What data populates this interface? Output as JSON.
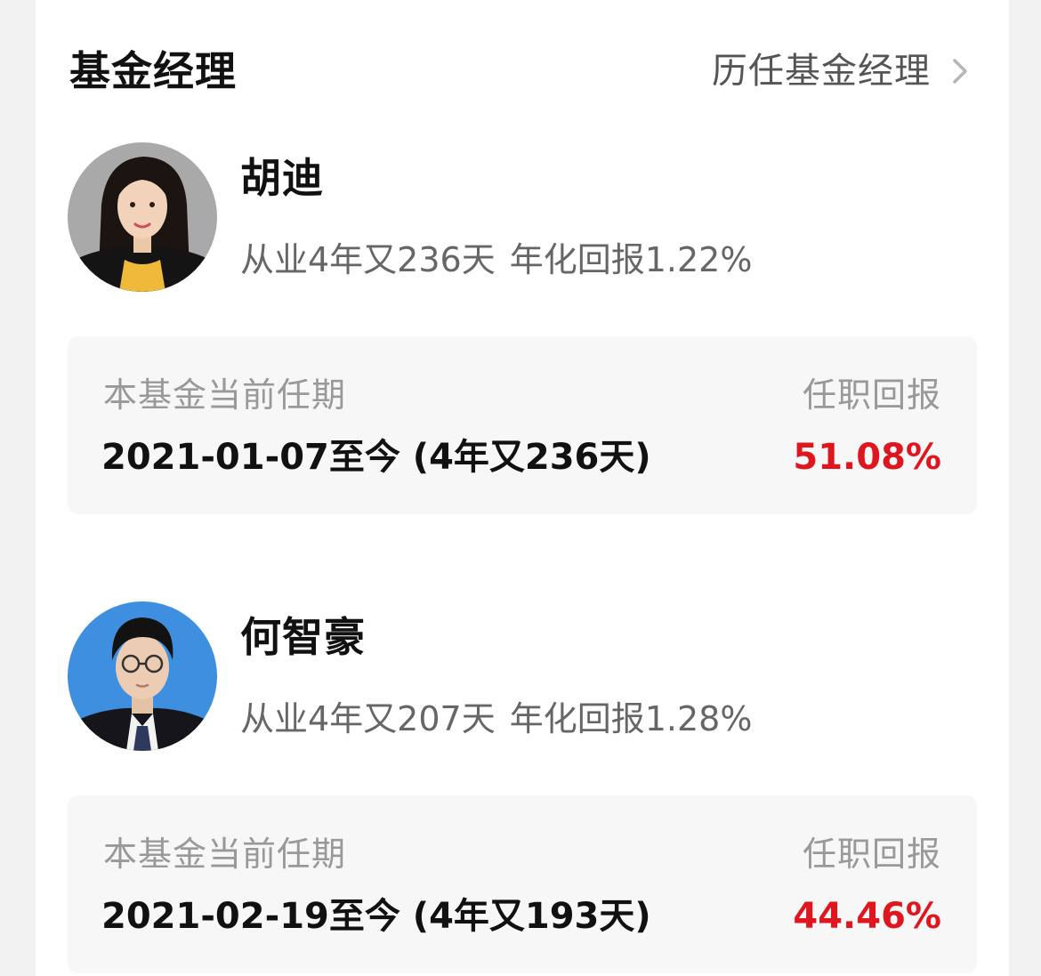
{
  "header": {
    "title": "基金经理",
    "history_link": "历任基金经理",
    "history_icon": "chevron-right-icon"
  },
  "colors": {
    "return_positive": "#e0161f",
    "text_primary": "#111111",
    "text_secondary": "#666666",
    "text_muted": "#999999"
  },
  "managers": [
    {
      "name": "胡迪",
      "experience": "从业4年又236天",
      "annual_return": "年化回报1.22%",
      "tenure_label": "本基金当前任期",
      "tenure_period": "2021-01-07至今 (4年又236天)",
      "return_label": "任职回报",
      "return_value": "51.08%"
    },
    {
      "name": "何智豪",
      "experience": "从业4年又207天",
      "annual_return": "年化回报1.28%",
      "tenure_label": "本基金当前任期",
      "tenure_period": "2021-02-19至今 (4年又193天)",
      "return_label": "任职回报",
      "return_value": "44.46%"
    }
  ]
}
